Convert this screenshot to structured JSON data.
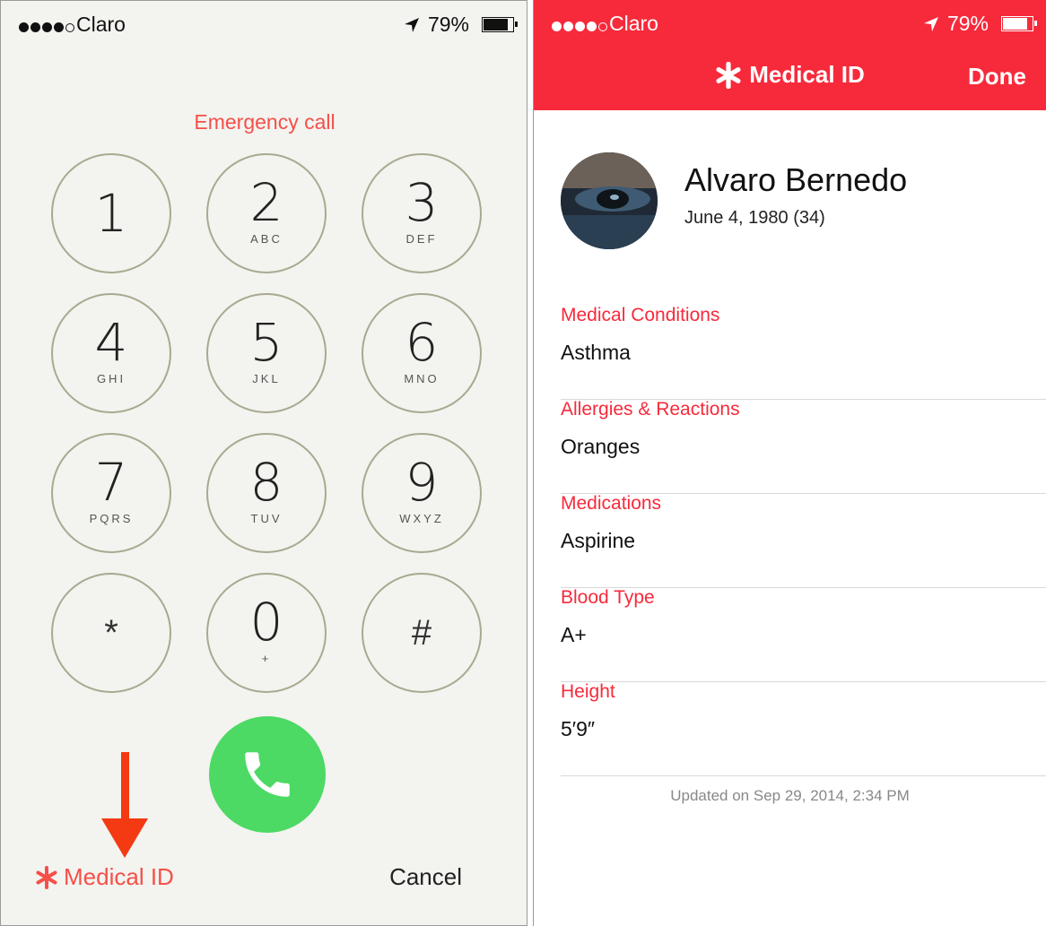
{
  "left": {
    "status": {
      "carrier": "Claro",
      "battery": "79%",
      "battery_level": 0.79
    },
    "title": "Emergency call",
    "keys": [
      {
        "digit": "1",
        "letters": ""
      },
      {
        "digit": "2",
        "letters": "ABC"
      },
      {
        "digit": "3",
        "letters": "DEF"
      },
      {
        "digit": "4",
        "letters": "GHI"
      },
      {
        "digit": "5",
        "letters": "JKL"
      },
      {
        "digit": "6",
        "letters": "MNO"
      },
      {
        "digit": "7",
        "letters": "PQRS"
      },
      {
        "digit": "8",
        "letters": "TUV"
      },
      {
        "digit": "9",
        "letters": "WXYZ"
      },
      {
        "digit": "*",
        "letters": ""
      },
      {
        "digit": "0",
        "letters": "+"
      },
      {
        "digit": "#",
        "letters": ""
      }
    ],
    "medical_id_label": "Medical ID",
    "cancel_label": "Cancel",
    "colors": {
      "accent": "#f4504a",
      "call": "#4cd964",
      "arrow": "#f33a12"
    }
  },
  "right": {
    "status": {
      "carrier": "Claro",
      "battery": "79%",
      "battery_level": 0.79
    },
    "nav_title": "Medical ID",
    "done_label": "Done",
    "profile": {
      "name": "Alvaro Bernedo",
      "dob": "June 4, 1980 (34)"
    },
    "sections": [
      {
        "label": "Medical Conditions",
        "value": "Asthma"
      },
      {
        "label": "Allergies & Reactions",
        "value": "Oranges"
      },
      {
        "label": "Medications",
        "value": "Aspirine"
      },
      {
        "label": "Blood Type",
        "value": "A+"
      },
      {
        "label": "Height",
        "value": "5′9″"
      }
    ],
    "updated": "Updated on Sep 29, 2014, 2:34 PM",
    "colors": {
      "header": "#f72a3b"
    }
  }
}
